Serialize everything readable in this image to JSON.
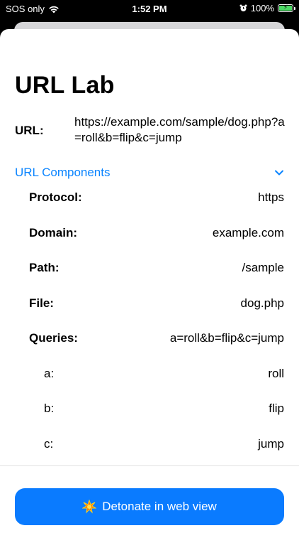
{
  "status_bar": {
    "carrier": "SOS only",
    "time": "1:52 PM",
    "battery": "100%",
    "battery_level": 1.0
  },
  "page": {
    "title": "URL Lab",
    "url_label": "URL:",
    "url_value": "https://example.com/sample/dog.php?a=roll&b=flip&c=jump"
  },
  "components": {
    "label": "URL Components",
    "rows": [
      {
        "key": "Protocol:",
        "value": "https",
        "style": "bold"
      },
      {
        "key": "Domain:",
        "value": "example.com",
        "style": "bold"
      },
      {
        "key": "Path:",
        "value": "/sample",
        "style": "bold"
      },
      {
        "key": "File:",
        "value": "dog.php",
        "style": "bold"
      },
      {
        "key": "Queries:",
        "value": "a=roll&b=flip&c=jump",
        "style": "bold"
      },
      {
        "key": "a:",
        "value": "roll",
        "style": "sub"
      },
      {
        "key": "b:",
        "value": "flip",
        "style": "sub"
      },
      {
        "key": "c:",
        "value": "jump",
        "style": "sub"
      }
    ]
  },
  "action": {
    "label": "Detonate in web view",
    "icon": "collision-icon"
  },
  "colors": {
    "accent": "#0a84ff",
    "button": "#0a7bff"
  }
}
